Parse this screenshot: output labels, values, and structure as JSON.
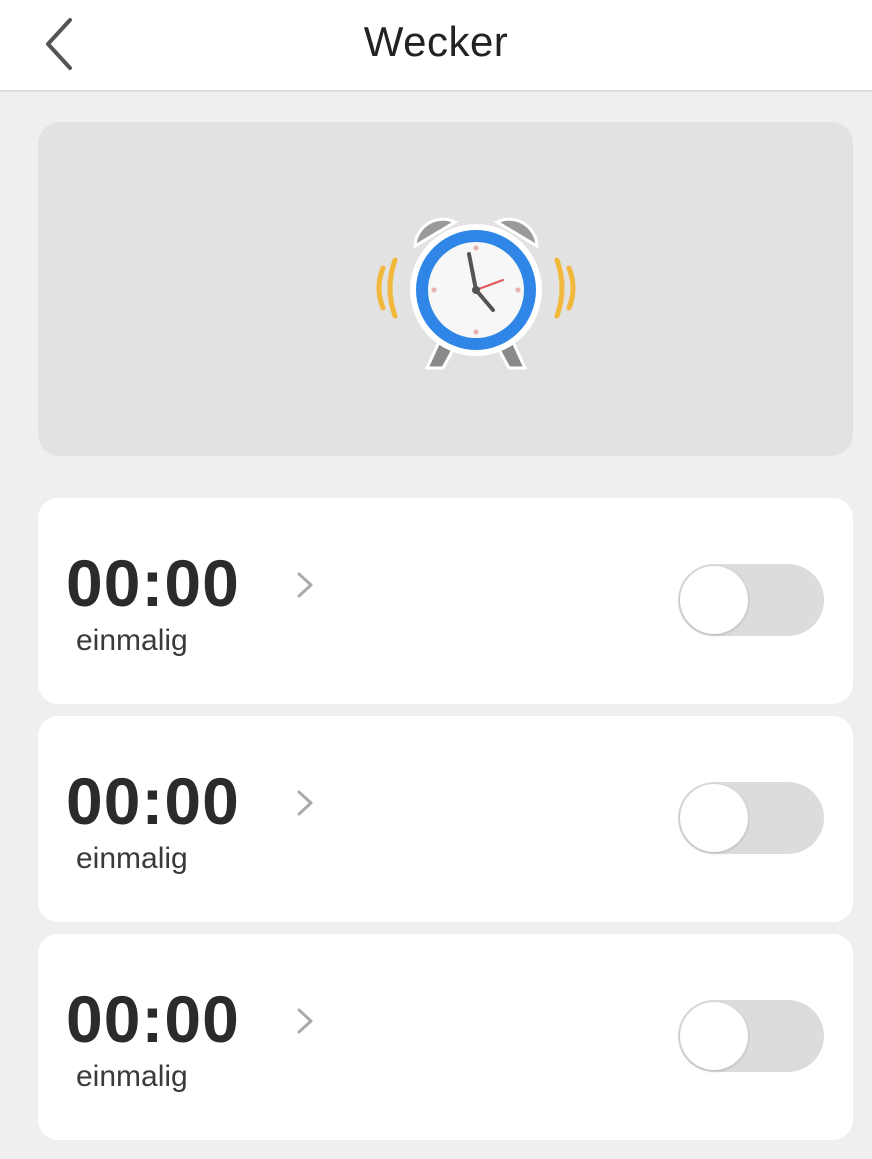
{
  "header": {
    "title": "Wecker",
    "back_icon": "chevron-left-icon"
  },
  "hero": {
    "icon": "alarm-clock-icon"
  },
  "alarms": [
    {
      "time": "00:00",
      "repeat": "einmalig",
      "enabled": false
    },
    {
      "time": "00:00",
      "repeat": "einmalig",
      "enabled": false
    },
    {
      "time": "00:00",
      "repeat": "einmalig",
      "enabled": false
    }
  ],
  "colors": {
    "background": "#efefef",
    "hero_background": "#e2e2e2",
    "clock_ring": "#2f86e6",
    "vibration_lines": "#f1b83c",
    "toggle_off": "#dcdcdc"
  }
}
